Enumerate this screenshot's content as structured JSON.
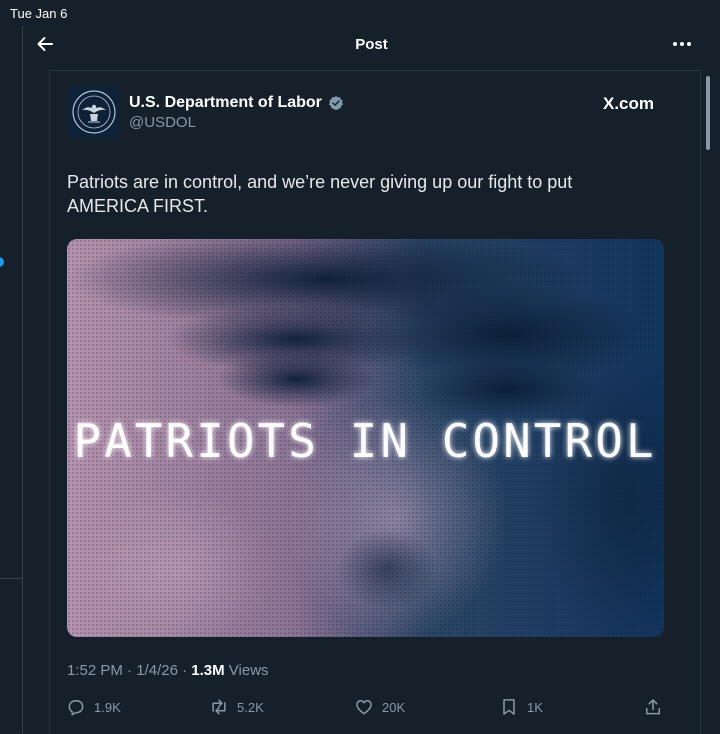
{
  "status_bar": {
    "time": "Tue Jan 6"
  },
  "header": {
    "title": "Post"
  },
  "post": {
    "author": {
      "display_name": "U.S. Department of Labor",
      "handle": "@USDOL",
      "verified": true
    },
    "source_label": "X.com",
    "text_line1": "Patriots are in control, and we’re never giving up our fight to put",
    "text_line2": "AMERICA FIRST.",
    "media": {
      "overlay_text": "PATRIOTS IN CONTROL"
    },
    "meta": {
      "time": "1:52 PM",
      "sep1": " · ",
      "date": "1/4/26",
      "sep2": " · ",
      "views_count": "1.3M",
      "views_label": " Views"
    },
    "actions": {
      "replies": "1.9K",
      "reposts": "5.2K",
      "likes": "20K",
      "bookmarks": "1K"
    }
  },
  "colors": {
    "background": "#15202b",
    "accent": "#1d9bf0",
    "muted": "#8b98a5",
    "text": "#e7e9ea",
    "verified_badge": "#829aab"
  },
  "icons": [
    "back-arrow-icon",
    "more-icon",
    "verified-badge-icon",
    "reply-icon",
    "repost-icon",
    "like-icon",
    "bookmark-icon",
    "share-icon"
  ]
}
